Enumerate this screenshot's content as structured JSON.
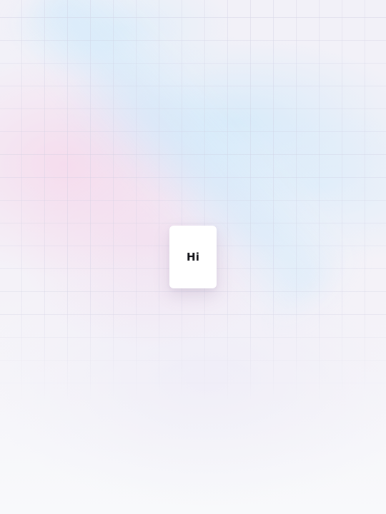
{
  "card": {
    "text": "Hi"
  },
  "colors": {
    "card_background": "#ffffff",
    "text": "#121217",
    "pink_glow": "#f7cbe5",
    "blue_glow": "#cde8fa",
    "page_background": "#f7f8fb"
  }
}
